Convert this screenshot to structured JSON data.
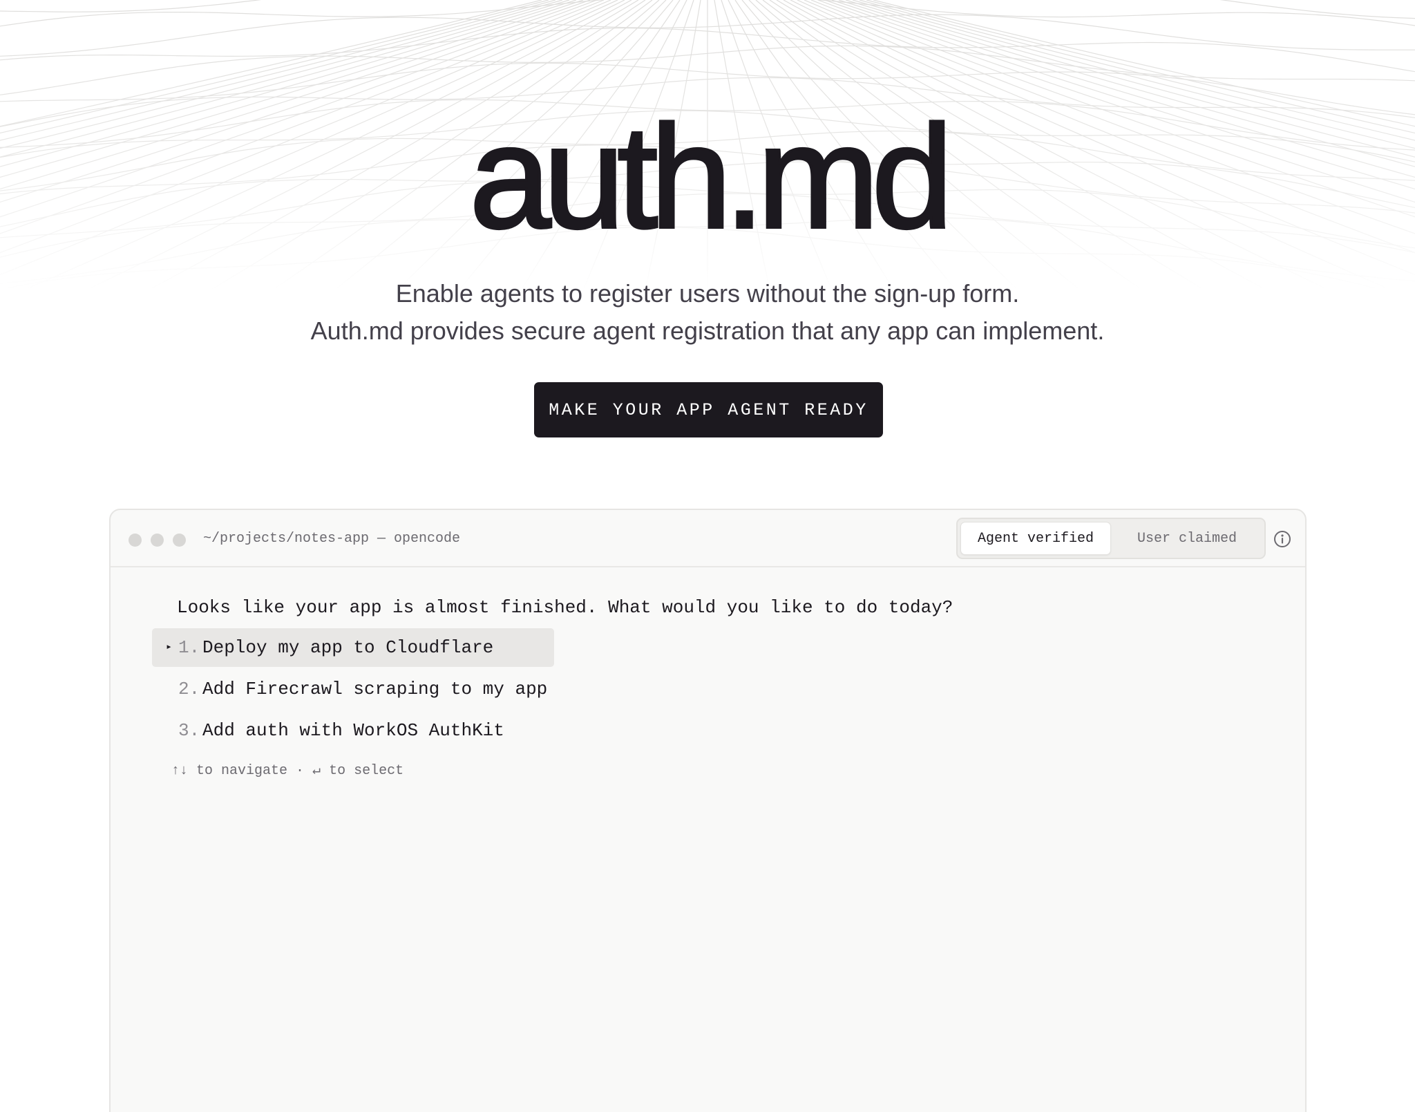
{
  "hero": {
    "title": "auth.md",
    "subtitle_line1": "Enable agents to register users without the sign-up form.",
    "subtitle_line2": "Auth.md provides secure agent registration that any app can implement.",
    "cta_label": "MAKE YOUR APP AGENT READY"
  },
  "terminal": {
    "title": "~/projects/notes-app — opencode",
    "segments": {
      "active": "Agent verified",
      "inactive": "User claimed"
    },
    "info_icon": "info-icon",
    "prompt": "Looks like your app is almost finished. What would you like to do today?",
    "selected_marker": "▸",
    "options": [
      {
        "number": "1.",
        "label": "Deploy my app to Cloudflare",
        "selected": true
      },
      {
        "number": "2.",
        "label": "Add Firecrawl scraping to my app",
        "selected": false
      },
      {
        "number": "3.",
        "label": "Add auth with WorkOS AuthKit",
        "selected": false
      }
    ],
    "hint": "↑↓ to navigate · ↵ to select"
  },
  "colors": {
    "text_primary": "#1c191f",
    "text_secondary": "#43404a",
    "button_bg": "#1c191f",
    "terminal_bg": "#f9f9f8",
    "selected_row_bg": "#e8e7e5"
  }
}
